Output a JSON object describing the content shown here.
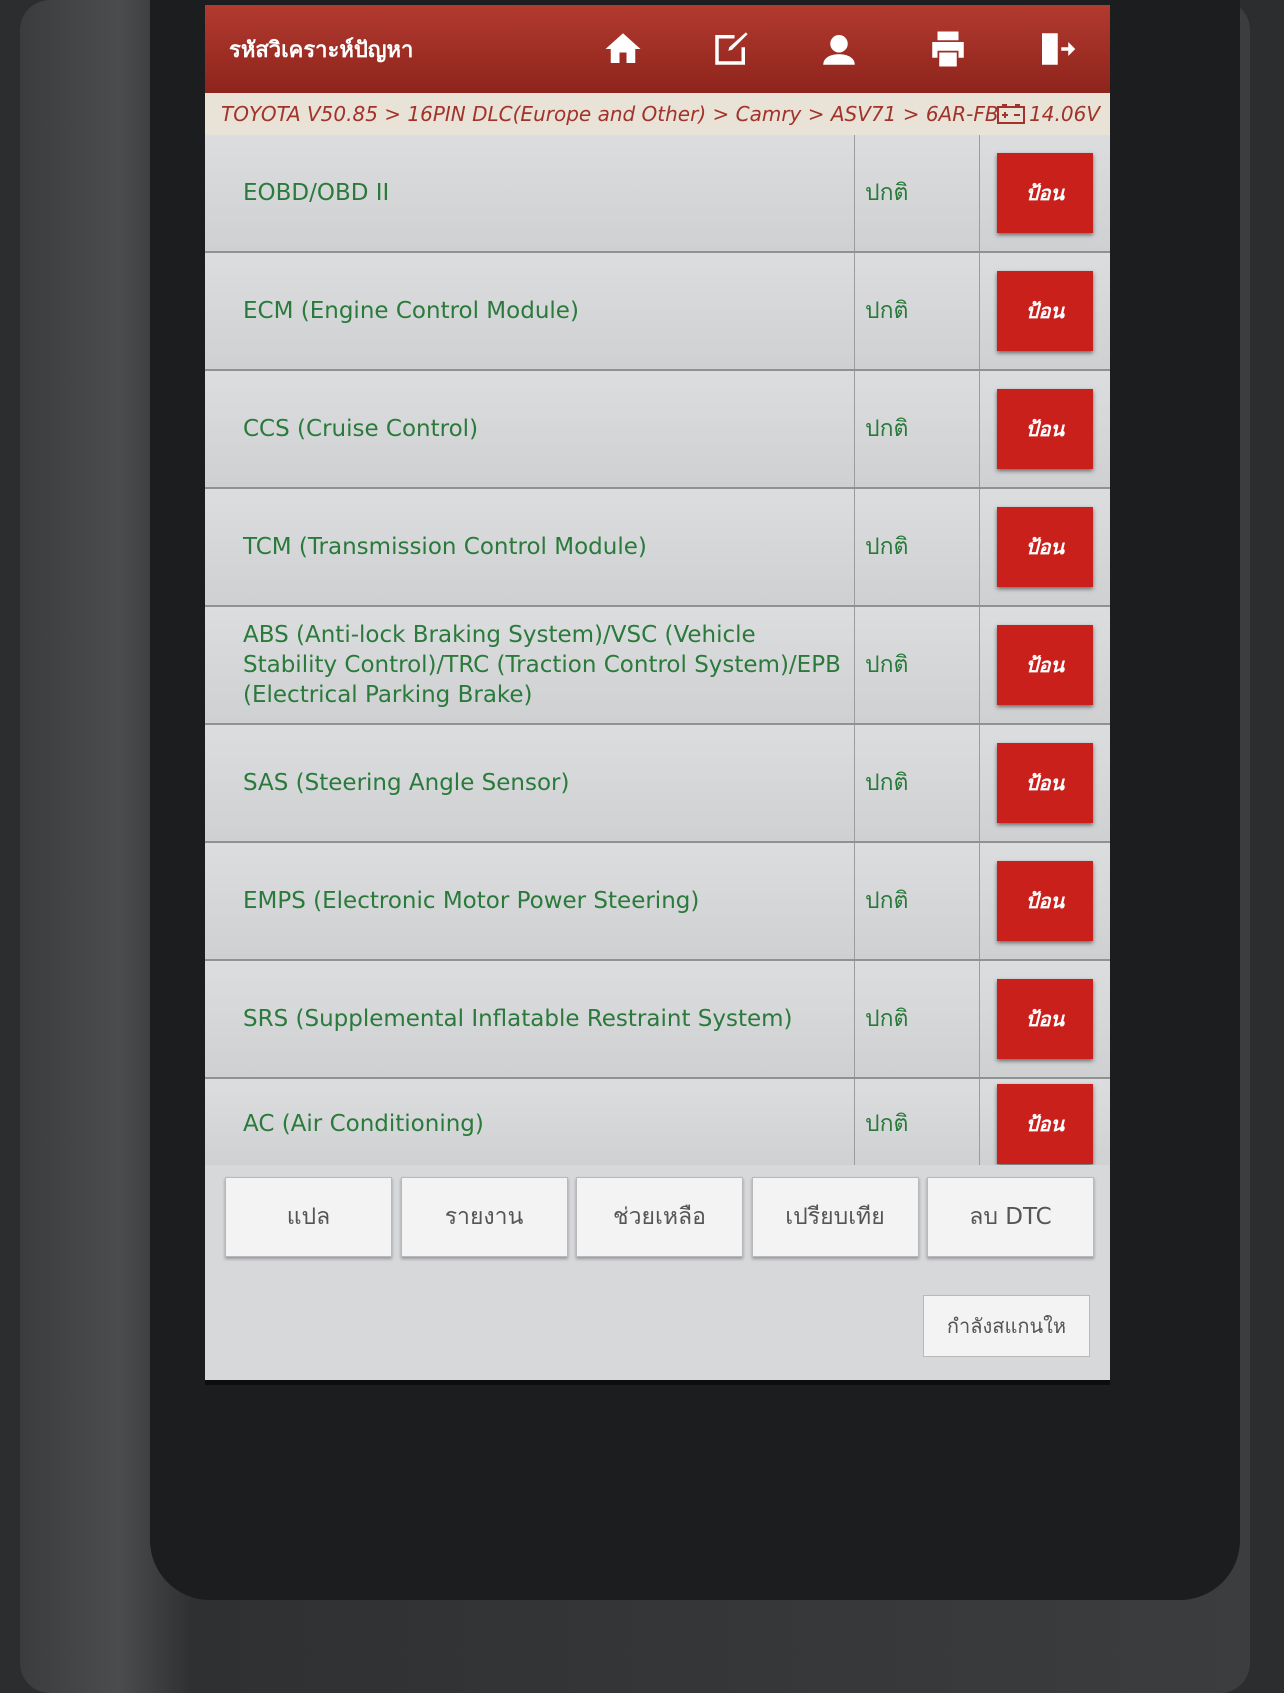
{
  "header": {
    "title": "รหัสวิเคราะห์ปัญหา",
    "tools": [
      {
        "icon": "home-icon"
      },
      {
        "icon": "edit-icon"
      },
      {
        "icon": "user-icon"
      },
      {
        "icon": "print-icon"
      },
      {
        "icon": "exit-icon"
      }
    ]
  },
  "breadcrumb": {
    "path": "TOYOTA V50.85 > 16PIN DLC(Europe and Other) > Camry > ASV71 > 6AR-FBS",
    "voltage": "14.06V",
    "voltage_icon": "battery-icon"
  },
  "systems": [
    {
      "name": "EOBD/OBD II",
      "status": "ปกติ",
      "button": "ป้อน"
    },
    {
      "name": "ECM (Engine Control Module)",
      "status": "ปกติ",
      "button": "ป้อน"
    },
    {
      "name": "CCS (Cruise Control)",
      "status": "ปกติ",
      "button": "ป้อน"
    },
    {
      "name": "TCM (Transmission Control Module)",
      "status": "ปกติ",
      "button": "ป้อน"
    },
    {
      "name": "ABS (Anti-lock Braking System)/VSC (Vehicle Stability Control)/TRC (Traction Control System)/EPB (Electrical Parking Brake)",
      "status": "ปกติ",
      "button": "ป้อน"
    },
    {
      "name": "SAS (Steering Angle Sensor)",
      "status": "ปกติ",
      "button": "ป้อน"
    },
    {
      "name": "EMPS (Electronic Motor Power Steering)",
      "status": "ปกติ",
      "button": "ป้อน"
    },
    {
      "name": "SRS (Supplemental Inflatable Restraint System)",
      "status": "ปกติ",
      "button": "ป้อน"
    },
    {
      "name": "AC (Air Conditioning)",
      "status": "ปกติ",
      "button": "ป้อน"
    }
  ],
  "actions": [
    "แปล",
    "รายงาน",
    "ช่วยเหลือ",
    "เปรียบเทีย",
    "ลบ DTC"
  ],
  "scan_button": "กำลังสแกนให",
  "colors": {
    "header": "#b23a2f",
    "button": "#c9201c",
    "text": "#2a7a3b"
  }
}
